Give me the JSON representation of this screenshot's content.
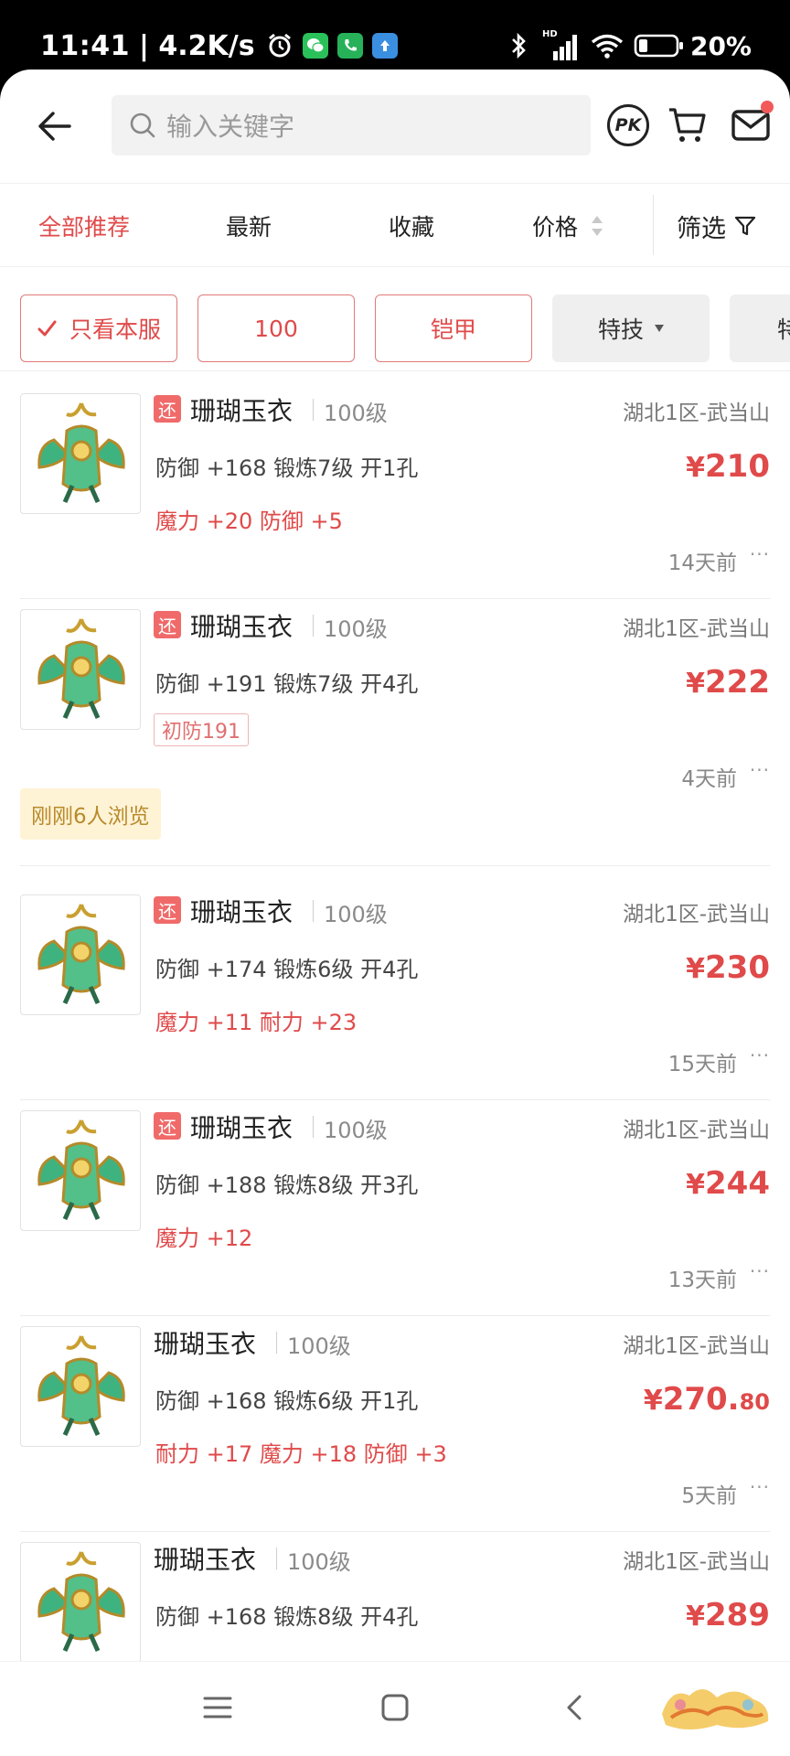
{
  "status_bar": {
    "time": "11:41",
    "net_speed": "| 4.2K/s",
    "battery": "20%",
    "hd_label": "HD"
  },
  "header": {
    "search_placeholder": "输入关键字",
    "pk_label": "PK"
  },
  "sort_bar": {
    "tabs": [
      "全部推荐",
      "最新",
      "收藏",
      "价格"
    ],
    "active_index": 0,
    "filter_label": "筛选"
  },
  "chips": [
    "只看本服",
    "100",
    "铠甲",
    "特技",
    "特"
  ],
  "listings": [
    {
      "returnable": true,
      "tag": "还",
      "name": "珊瑚玉衣",
      "level": "100级",
      "server": "湖北1区-武当山",
      "stats": "防御 +168 锻炼7级 开1孔",
      "bonus": "魔力 +20 防御 +5",
      "price_yen": "¥",
      "price_int": "210",
      "price_cents": "",
      "time": "14天前",
      "more": "···"
    },
    {
      "returnable": true,
      "tag": "还",
      "name": "珊瑚玉衣",
      "level": "100级",
      "server": "湖北1区-武当山",
      "stats": "防御 +191 锻炼7级 开4孔",
      "badge": "初防191",
      "price_yen": "¥",
      "price_int": "222",
      "price_cents": "",
      "time": "4天前",
      "more": "···"
    },
    {
      "returnable": true,
      "tag": "还",
      "name": "珊瑚玉衣",
      "level": "100级",
      "server": "湖北1区-武当山",
      "stats": "防御 +174 锻炼6级 开4孔",
      "bonus": "魔力 +11 耐力 +23",
      "price_yen": "¥",
      "price_int": "230",
      "price_cents": "",
      "time": "15天前",
      "more": "···"
    },
    {
      "returnable": true,
      "tag": "还",
      "name": "珊瑚玉衣",
      "level": "100级",
      "server": "湖北1区-武当山",
      "stats": "防御 +188 锻炼8级 开3孔",
      "bonus": "魔力 +12",
      "price_yen": "¥",
      "price_int": "244",
      "price_cents": "",
      "time": "13天前",
      "more": "···"
    },
    {
      "returnable": false,
      "name": "珊瑚玉衣",
      "level": "100级",
      "server": "湖北1区-武当山",
      "stats": "防御 +168 锻炼6级 开1孔",
      "bonus": "耐力 +17 魔力 +18 防御 +3",
      "price_yen": "¥",
      "price_int": "270.",
      "price_cents": "80",
      "time": "5天前",
      "more": "···"
    },
    {
      "returnable": false,
      "name": "珊瑚玉衣",
      "level": "100级",
      "server": "湖北1区-武当山",
      "stats": "防御 +168 锻炼8级 开4孔",
      "price_yen": "¥",
      "price_int": "289",
      "price_cents": ""
    }
  ],
  "views_badge": "刚刚6人浏览",
  "colors": {
    "accent": "#e04a4a",
    "tag_bg": "#f06a6a",
    "views_bg": "#fff3d6",
    "views_text": "#b88a2a"
  }
}
